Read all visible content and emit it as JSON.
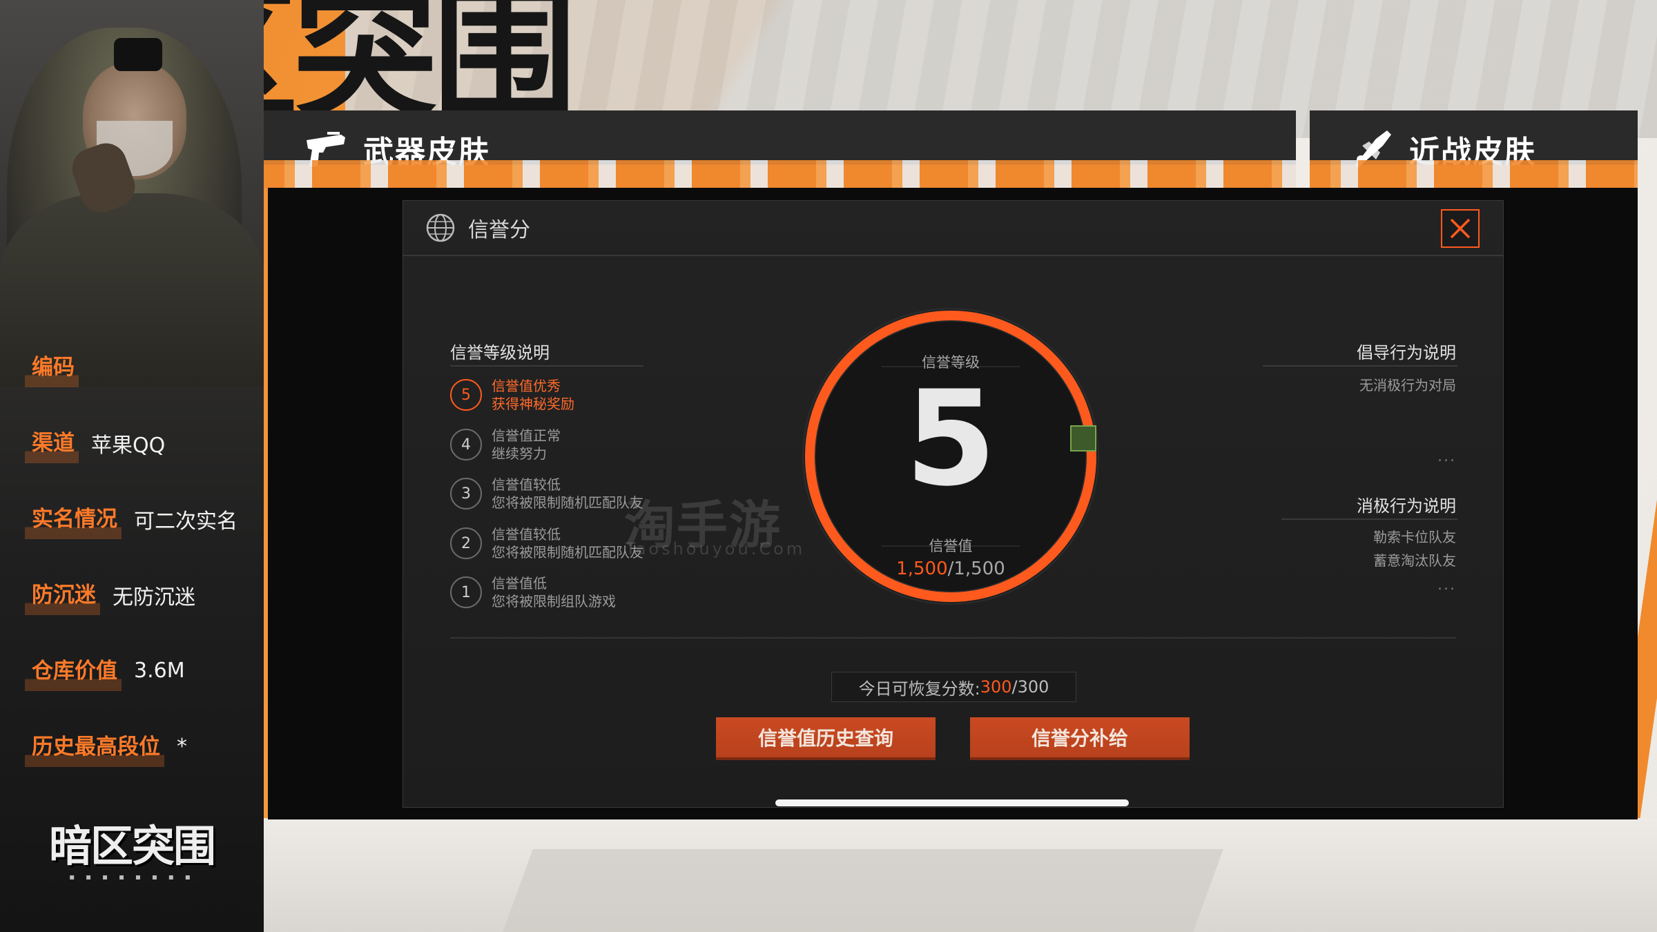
{
  "background": {
    "game_title": "暗区突围"
  },
  "tabs": [
    {
      "label": "武器皮肤",
      "icon": "pistol-icon"
    },
    {
      "label": "近战皮肤",
      "icon": "melee-icon"
    }
  ],
  "profile": {
    "rows": [
      {
        "label": "编码",
        "value": ""
      },
      {
        "label": "渠道",
        "value": "苹果QQ"
      },
      {
        "label": "实名情况",
        "value": "可二次实名"
      },
      {
        "label": "防沉迷",
        "value": "无防沉迷"
      },
      {
        "label": "仓库价值",
        "value": "3.6M"
      },
      {
        "label": "历史最高段位",
        "value": "*"
      }
    ],
    "logo_text": "暗区突围"
  },
  "modal": {
    "title": "信誉分",
    "levels_title": "信誉等级说明",
    "levels": [
      {
        "level": "5",
        "line1": "信誉值优秀",
        "line2": "获得神秘奖励",
        "active": true
      },
      {
        "level": "4",
        "line1": "信誉值正常",
        "line2": "继续努力",
        "active": false
      },
      {
        "level": "3",
        "line1": "信誉值较低",
        "line2": "您将被限制随机匹配队友",
        "active": false
      },
      {
        "level": "2",
        "line1": "信誉值较低",
        "line2": "您将被限制随机匹配队友",
        "active": false
      },
      {
        "level": "1",
        "line1": "信誉值低",
        "line2": "您将被限制组队游戏",
        "active": false
      }
    ],
    "gauge": {
      "level_label": "信誉等级",
      "level_value": "5",
      "score_label": "信誉值",
      "score_current": "1,500",
      "score_max": "/1,500",
      "progress": 1.0
    },
    "watermark": "淘手游",
    "watermark_sub": "Taoshouyou.Com",
    "positive_title": "倡导行为说明",
    "positive_items": [
      "无消极行为对局"
    ],
    "negative_title": "消极行为说明",
    "negative_items": [
      "勒索卡位队友",
      "蓄意淘汰队友"
    ],
    "more": "...",
    "recover_label": "今日可恢复分数:",
    "recover_current": "300",
    "recover_max": "/300",
    "btn_history": "信誉值历史查询",
    "btn_supply": "信誉分补给"
  },
  "colors": {
    "accent": "#ff5a1e",
    "orange_bg": "#f08a2c"
  }
}
